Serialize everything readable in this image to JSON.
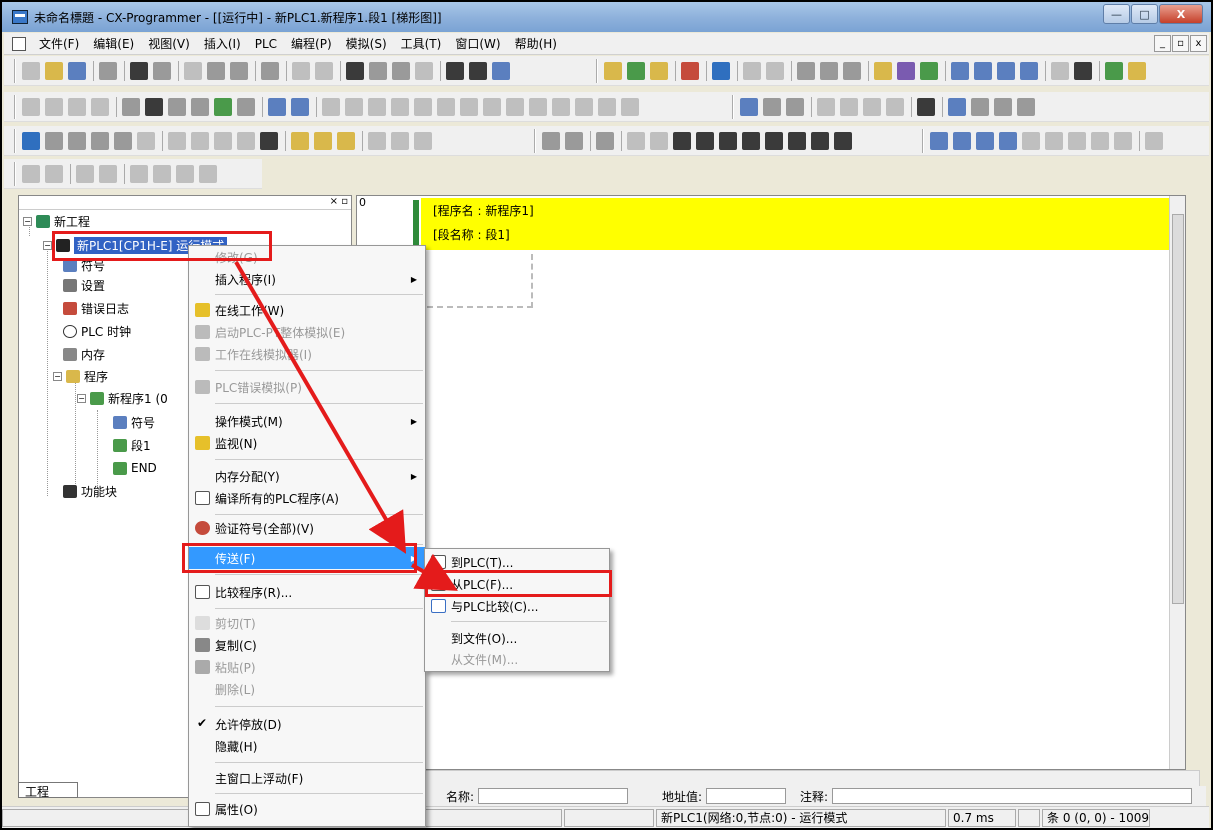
{
  "window": {
    "title": "未命名標題 - CX-Programmer - [[运行中] - 新PLC1.新程序1.段1 [梯形图]]",
    "buttons": {
      "minimize": "—",
      "maximize": "□",
      "close": "X"
    }
  },
  "menubar": {
    "items": [
      "文件(F)",
      "编辑(E)",
      "视图(V)",
      "插入(I)",
      "PLC",
      "编程(P)",
      "模拟(S)",
      "工具(T)",
      "窗口(W)",
      "帮助(H)"
    ],
    "mdi_controls": [
      "_",
      "▫",
      "x"
    ]
  },
  "project_tree": {
    "root": "新工程",
    "plc": "新PLC1[CP1H-E] 运行模式",
    "items": [
      "符号",
      "设置",
      "错误日志",
      "PLC 时钟",
      "内存",
      "程序",
      "新程序1 (0",
      "符号",
      "段1",
      "END",
      "功能块"
    ],
    "tab_label": "工程"
  },
  "editor": {
    "rung_number": "0",
    "program_name_line": "[程序名 : 新程序1]",
    "section_name_line": "[段名称 : 段1]"
  },
  "info_bar": {
    "name_label": "名称:",
    "address_label": "地址值:",
    "comment_label": "注释:"
  },
  "status_bar": {
    "plc_status": "新PLC1(网络:0,节点:0) - 运行模式",
    "cycle_time": "0.7 ms",
    "position": "条 0 (0, 0) - 1009"
  },
  "context_menu": {
    "items": [
      {
        "label": "修改(G)",
        "disabled": true
      },
      {
        "label": "插入程序(I)",
        "submenu": true
      },
      {
        "label": "在线工作(W)"
      },
      {
        "label": "启动PLC-PT整体模拟(E)",
        "disabled": true
      },
      {
        "label": "工作在线模拟器(I)",
        "disabled": true
      },
      {
        "label": "PLC错误模拟(P)",
        "disabled": true
      },
      {
        "label": "操作模式(M)",
        "submenu": true
      },
      {
        "label": "监视(N)"
      },
      {
        "label": "内存分配(Y)",
        "submenu": true
      },
      {
        "label": "编译所有的PLC程序(A)"
      },
      {
        "label": "验证符号(全部)(V)"
      },
      {
        "label": "传送(F)",
        "submenu": true,
        "highlighted": true
      },
      {
        "label": "比较程序(R)..."
      },
      {
        "label": "剪切(T)",
        "disabled": true
      },
      {
        "label": "复制(C)"
      },
      {
        "label": "粘贴(P)",
        "disabled": true
      },
      {
        "label": "删除(L)",
        "disabled": true
      },
      {
        "label": "允许停放(D)",
        "checked": true,
        "check_mark": "✔"
      },
      {
        "label": "隐藏(H)"
      },
      {
        "label": "主窗口上浮动(F)"
      },
      {
        "label": "属性(O)"
      }
    ]
  },
  "transfer_submenu": {
    "items": [
      {
        "label": "到PLC(T)..."
      },
      {
        "label": "从PLC(F)..."
      },
      {
        "label": "与PLC比较(C)..."
      },
      {
        "label": "到文件(O)..."
      },
      {
        "label": "从文件(M)...",
        "disabled": true
      }
    ]
  },
  "colors": {
    "ladder_header": "#ffff00",
    "selection": "#3399ff",
    "annotation": "#e41b1b"
  }
}
